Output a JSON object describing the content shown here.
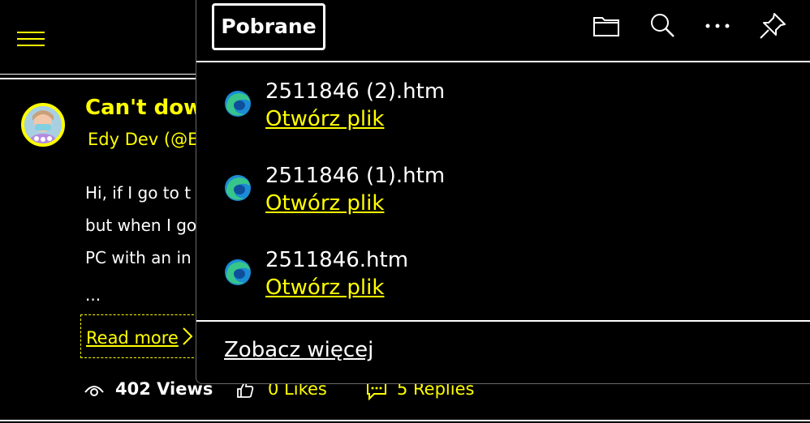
{
  "post": {
    "title": "Can't dow",
    "author": "Edy Dev (@E",
    "lines": [
      "Hi, if I go to t",
      "but when I go",
      "PC with an in",
      "..."
    ],
    "read_more": "Read more",
    "views": "402 Views",
    "likes": "0 Likes",
    "replies": "5 Replies"
  },
  "downloads": {
    "title": "Pobrane",
    "toolbar_icons": [
      "folder-icon",
      "search-icon",
      "more-icon",
      "pin-icon"
    ],
    "items": [
      {
        "name": "2511846 (2).htm",
        "action": "Otwórz plik"
      },
      {
        "name": "2511846 (1).htm",
        "action": "Otwórz plik"
      },
      {
        "name": "2511846.htm",
        "action": "Otwórz plik"
      }
    ],
    "see_more": "Zobacz więcej"
  },
  "colors": {
    "accent": "#ffff00",
    "background": "#000000",
    "text": "#ffffff"
  }
}
